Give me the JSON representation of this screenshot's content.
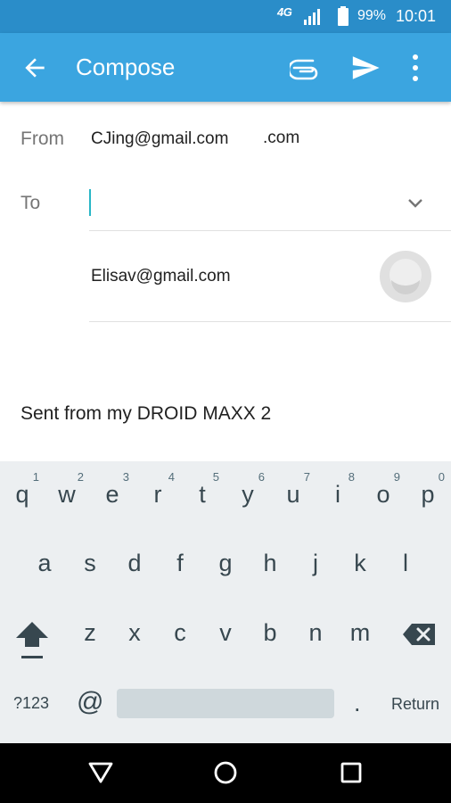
{
  "status_bar": {
    "network": "4G",
    "battery_percent": "99%",
    "time": "10:01"
  },
  "app_bar": {
    "title": "Compose",
    "back_icon": "arrow-back-icon",
    "attach_icon": "paperclip-icon",
    "send_icon": "send-icon",
    "more_icon": "more-vert-icon"
  },
  "compose": {
    "from_label": "From",
    "from_value": "CJing@gmail.com",
    "from_suffix": ".com",
    "to_label": "To",
    "to_value": "",
    "suggestion_email": "Elisav@gmail.com",
    "signature": "Sent from my DROID MAXX 2"
  },
  "keyboard": {
    "row1": [
      {
        "key": "q",
        "hint": "1"
      },
      {
        "key": "w",
        "hint": "2"
      },
      {
        "key": "e",
        "hint": "3"
      },
      {
        "key": "r",
        "hint": "4"
      },
      {
        "key": "t",
        "hint": "5"
      },
      {
        "key": "y",
        "hint": "6"
      },
      {
        "key": "u",
        "hint": "7"
      },
      {
        "key": "i",
        "hint": "8"
      },
      {
        "key": "o",
        "hint": "9"
      },
      {
        "key": "p",
        "hint": "0"
      }
    ],
    "row2": [
      "a",
      "s",
      "d",
      "f",
      "g",
      "h",
      "j",
      "k",
      "l"
    ],
    "row3": [
      "z",
      "x",
      "c",
      "v",
      "b",
      "n",
      "m"
    ],
    "symbols_label": "?123",
    "at_label": "@",
    "period_label": ".",
    "return_label": "Return"
  },
  "colors": {
    "status_bar": "#2a8dc9",
    "app_bar": "#3ba5e0",
    "cursor": "#29b6c6",
    "keyboard_bg": "#eceff1"
  }
}
